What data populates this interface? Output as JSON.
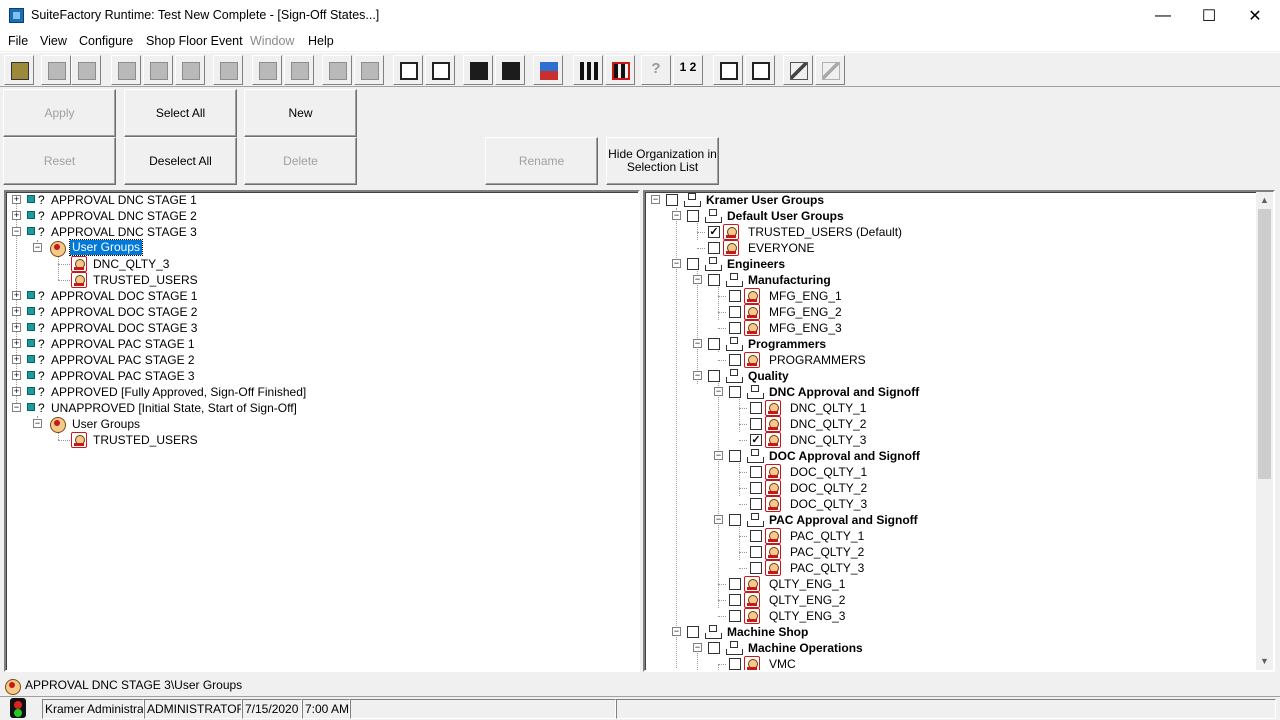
{
  "window": {
    "title": "SuiteFactory Runtime: Test New Complete - [Sign-Off States...]",
    "minimize_glyph": "—",
    "maximize_glyph": "☐",
    "close_glyph": "✕"
  },
  "menu": {
    "items": [
      "File",
      "View",
      "Configure",
      "Shop Floor Event",
      "Window",
      "Help"
    ]
  },
  "toolbar": {
    "numbered_glyph": "1 2",
    "help_glyph": "?"
  },
  "actions": {
    "apply": "Apply",
    "select_all": "Select All",
    "new": "New",
    "reset": "Reset",
    "deselect_all": "Deselect All",
    "delete": "Delete",
    "rename": "Rename",
    "hide_org_line1": "Hide Organization in",
    "hide_org_line2": "Selection List"
  },
  "left_tree": {
    "states": [
      "APPROVAL DNC STAGE 1",
      "APPROVAL DNC STAGE 2",
      "APPROVAL DNC STAGE 3",
      "User Groups",
      "DNC_QLTY_3",
      "TRUSTED_USERS",
      "APPROVAL DOC STAGE 1",
      "APPROVAL DOC STAGE 2",
      "APPROVAL DOC STAGE 3",
      "APPROVAL PAC STAGE 1",
      "APPROVAL PAC STAGE 2",
      "APPROVAL PAC STAGE 3",
      "APPROVED [Fully Approved, Sign-Off Finished]",
      "UNAPPROVED [Initial State, Start of Sign-Off]",
      "User Groups",
      "TRUSTED_USERS"
    ],
    "question_mark": "?"
  },
  "right_tree": {
    "nodes": [
      "Kramer User Groups",
      "Default User Groups",
      "TRUSTED_USERS (Default)",
      "EVERYONE",
      "Engineers",
      "Manufacturing",
      "MFG_ENG_1",
      "MFG_ENG_2",
      "MFG_ENG_3",
      "Programmers",
      "PROGRAMMERS",
      "Quality",
      "DNC Approval and Signoff",
      "DNC_QLTY_1",
      "DNC_QLTY_2",
      "DNC_QLTY_3",
      "DOC Approval and Signoff",
      "DOC_QLTY_1",
      "DOC_QLTY_2",
      "DOC_QLTY_3",
      "PAC Approval and Signoff",
      "PAC_QLTY_1",
      "PAC_QLTY_2",
      "PAC_QLTY_3",
      "QLTY_ENG_1",
      "QLTY_ENG_2",
      "QLTY_ENG_3",
      "Machine Shop",
      "Machine Operations",
      "VMC"
    ],
    "checked": [
      "TRUSTED_USERS (Default)",
      "DNC_QLTY_3"
    ]
  },
  "path": {
    "text": "APPROVAL DNC STAGE 3\\User Groups"
  },
  "status": {
    "user": "Kramer Administrator",
    "role": "ADMINISTRATOR",
    "date": "7/15/2020",
    "time": "7:00 AM"
  }
}
